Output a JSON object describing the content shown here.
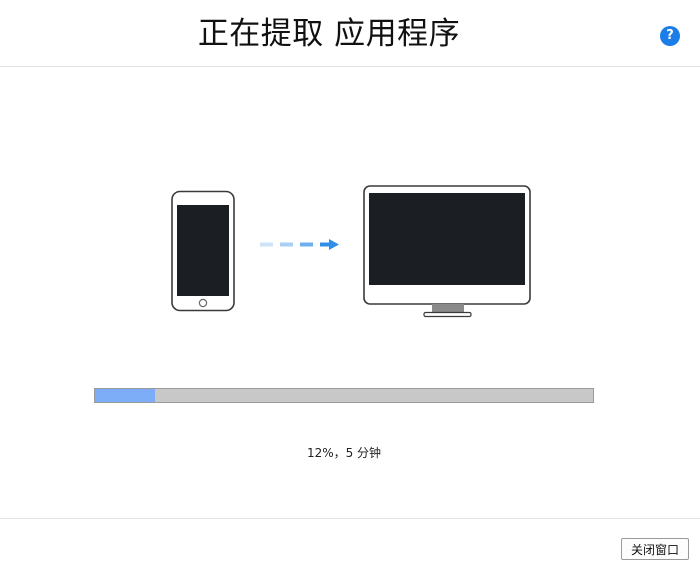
{
  "header": {
    "title": "正在提取 应用程序",
    "help_label": "?"
  },
  "illustration": {
    "source_icon": "phone-icon",
    "arrow_icon": "dashed-arrow-right-icon",
    "target_icon": "desktop-monitor-icon"
  },
  "progress": {
    "fraction": 0.12,
    "status_text": "12%，5 分钟"
  },
  "footer": {
    "close_label": "关闭窗口"
  },
  "colors": {
    "accent": "#1a7de8",
    "progress_fill": "#7eadf7",
    "progress_track": "#c8c8c8",
    "screen_dark": "#1b1f24",
    "arrow_blue": "#2f8fe6"
  }
}
